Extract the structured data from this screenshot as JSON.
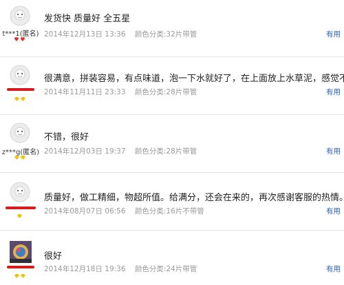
{
  "reviews": [
    {
      "username": "t***1(匿名)",
      "username_redacted": false,
      "badge": "red-hearts",
      "avatar": "default-avatar",
      "comment": "发货快 质量好 全五星",
      "date": "2014年12月13日 13:36",
      "spec": "颜色分类:32片带管",
      "useful": "有用"
    },
    {
      "username": "",
      "username_redacted": true,
      "badge": "gold-diamonds",
      "avatar": "default-avatar",
      "comment": "很满意，拼装容易，有点味道，泡一下水就好了，在上面放上水草泥，感觉不错",
      "date": "2014年11月11日 23:33",
      "spec": "颜色分类:28片带管",
      "useful": "有用"
    },
    {
      "username": "z***g(匿名)",
      "username_redacted": false,
      "badge": "gold-diamonds",
      "avatar": "default-avatar",
      "comment": "不错，很好",
      "date": "2014年12月03日 19:37",
      "spec": "颜色分类:28片带管",
      "useful": "有用"
    },
    {
      "username": "",
      "username_redacted": true,
      "badge": "gold-diamond",
      "avatar": "default-avatar",
      "comment": "质量好，做工精细，物超所值。给满分，还会在来的，再次感谢客服的热情。",
      "date": "2014年08月07日 06:56",
      "spec": "颜色分类:16片不带管",
      "useful": "有用"
    },
    {
      "username": "",
      "username_redacted": true,
      "badge": "gold-diamonds",
      "avatar": "photo-avatar",
      "comment": "很好",
      "date": "2014年12月18日 19:36",
      "spec": "颜色分类:24片带管",
      "useful": "有用"
    }
  ],
  "colors": {
    "link": "#2a63b8",
    "meta": "#9a9a9a",
    "redaction": "#d71a1a",
    "badge_gold": "#f2c200",
    "badge_red": "#e03030"
  }
}
